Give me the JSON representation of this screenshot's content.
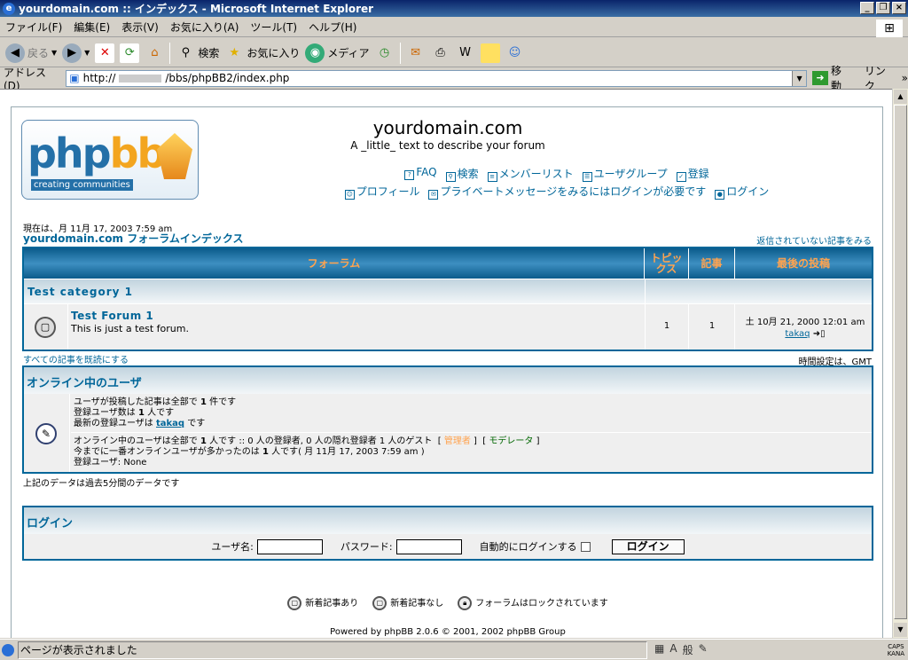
{
  "window": {
    "title": "yourdomain.com :: インデックス - Microsoft Internet Explorer",
    "buttons": [
      "_",
      "❐",
      "×"
    ]
  },
  "menu": [
    "ファイル(F)",
    "編集(E)",
    "表示(V)",
    "お気に入り(A)",
    "ツール(T)",
    "ヘルプ(H)"
  ],
  "toolbar": {
    "back": "戻る",
    "search": "検索",
    "favorites": "お気に入り",
    "media": "メディア"
  },
  "address": {
    "label": "アドレス(D)",
    "url_prefix": "http://",
    "url_suffix": "/bbs/phpBB2/index.php",
    "go": "移動",
    "links": "リンク"
  },
  "site": {
    "title": "yourdomain.com",
    "description": "A _little_ text to describe your forum",
    "logo_text_a": "php",
    "logo_text_b": "bb",
    "logo_tagline": "creating communities"
  },
  "nav": {
    "faq": "FAQ",
    "search": "検索",
    "members": "メンバーリスト",
    "groups": "ユーザグループ",
    "register": "登録",
    "profile": "プロフィール",
    "pm": "プライベートメッセージをみるにはログインが必要です",
    "login": "ログイン"
  },
  "datetime": "現在は、月 11月 17, 2003 7:59 am",
  "breadcrumb": "yourdomain.com フォーラムインデックス",
  "unanswered": "返信されていない記事をみる",
  "forum_table": {
    "headers": [
      "フォーラム",
      "トピックス",
      "記事",
      "最後の投稿"
    ],
    "category": "Test category 1",
    "forum": {
      "name": "Test Forum 1",
      "description": "This is just a test forum.",
      "topics": "1",
      "posts": "1",
      "last_post_date": "土 10月 21, 2000 12:01 am",
      "last_post_user": "takaq"
    }
  },
  "mark_read": "すべての記事を既読にする",
  "timezone": "時間設定は、GMT",
  "online": {
    "title": "オンライン中のユーザ",
    "line1_a": "ユーザが投稿した記事は全部で",
    "line1_n": "1",
    "line1_b": "件です",
    "line2_a": "登録ユーザ数は",
    "line2_n": "1",
    "line2_b": "人です",
    "line3_a": "最新の登録ユーザは",
    "line3_user": "takaq",
    "line3_b": "です",
    "line4_a": "オンライン中のユーザは全部で",
    "line4_n": "1",
    "line4_b": "人です :: 0 人の登録者, 0 人の隠れ登録者 1 人のゲスト",
    "admin": "管理者",
    "moderator": "モデレータ",
    "line5_a": "今までに一番オンラインユーザが多かったのは",
    "line5_n": "1",
    "line5_b": "人です( 月 11月 17, 2003 7:59 am )",
    "line6": "登録ユーザ: None"
  },
  "data_note": "上記のデータは過去5分間のデータです",
  "login": {
    "title": "ログイン",
    "username_label": "ユーザ名:",
    "password_label": "パスワード:",
    "autologin_label": "自動的にログインする",
    "submit": "ログイン"
  },
  "legend": {
    "new": "新着記事あり",
    "no_new": "新着記事なし",
    "locked": "フォーラムはロックされています"
  },
  "powered": "Powered by phpBB 2.0.6 © 2001, 2002 phpBB Group",
  "status": {
    "message": "ページが表示されました",
    "ime": [
      "▦",
      "A",
      "般",
      "✎"
    ],
    "caps": "CAPS",
    "kana": "KANA"
  }
}
